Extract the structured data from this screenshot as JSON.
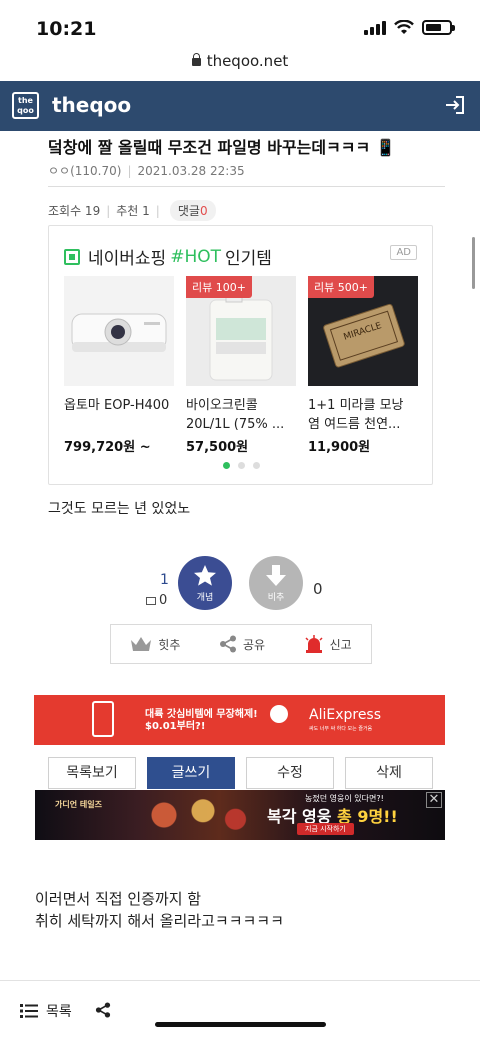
{
  "status": {
    "time": "10:21"
  },
  "browser": {
    "url": "theqoo.net"
  },
  "header": {
    "logo_text": "the qoo",
    "site_name": "theqoo"
  },
  "post": {
    "title": "덬창에 짤 올릴때 무조건 파일명 바꾸는데ㅋㅋㅋ 📱",
    "author": "ㅇㅇ(110.70)",
    "date": "2021.03.28 22:35",
    "views_label": "조회수 19",
    "recommend_label": "추천 1",
    "comments_label": "댓글",
    "comments_count": "0",
    "body_line1": "그것도 모르는 년 있었노",
    "body_line2": "이러면서 직접 인증까지 함",
    "body_line3": "취히 세탁까지 해서 올리라고ㅋㅋㅋㅋㅋ"
  },
  "ad": {
    "prefix": "네이버쇼핑",
    "hot": "#HOT",
    "suffix": "인기템",
    "tag": "AD",
    "products": [
      {
        "badge": "",
        "name": "옵토마 EOP-H400",
        "price": "799,720원 ~"
      },
      {
        "badge": "리뷰 100+",
        "name": "바이오크린콜 20L/1L (75% ...",
        "price": "57,500원"
      },
      {
        "badge": "리뷰 500+",
        "name": "1+1 미라클 모낭 염 여드름 천연...",
        "price": "11,900원"
      }
    ],
    "soap_text": "MIRACLE"
  },
  "vote": {
    "up_count": "1",
    "comment_count": "0",
    "up_label": "개념",
    "down_label": "비추",
    "down_count": "0"
  },
  "share_bar": {
    "hot": "힛추",
    "share": "공유",
    "report": "신고"
  },
  "ae_banner": {
    "line1": "대륙 갓심비템에 무장해제!",
    "line2": "$0.01부터?!",
    "brand": "AliExpress",
    "sub": "싸도 너무 싸 하다 모는 즐거움"
  },
  "actions": {
    "list": "목록보기",
    "write": "글쓰기",
    "edit": "수정",
    "delete": "삭제"
  },
  "game_banner": {
    "title": "가디언 테일즈",
    "line1": "농젔던 영웅이 있다면?!",
    "line2a": "복각 영웅",
    "line2b": "총 9명!!",
    "cta": "지금 시작하기",
    "close": "✕"
  },
  "bottom": {
    "list_label": "목록"
  },
  "colors": {
    "header": "#2d4a6e",
    "accent_green": "#2fbf5e",
    "vote_up": "#3b4d93",
    "badge_red": "#e04b4b"
  }
}
